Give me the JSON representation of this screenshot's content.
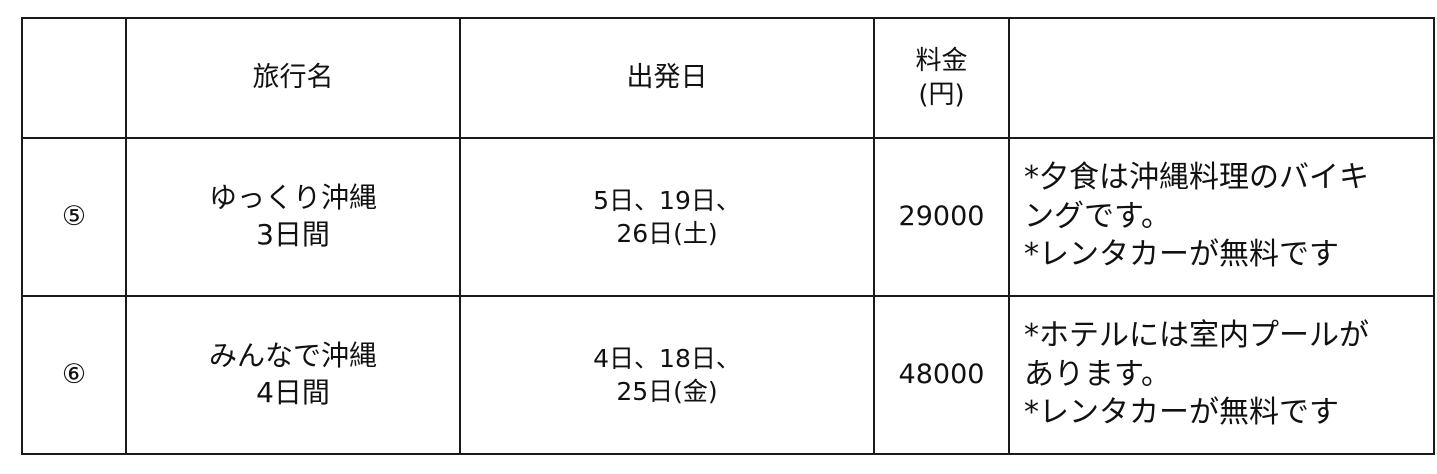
{
  "header": {
    "num": "",
    "name": "旅行名",
    "date": "出発日",
    "price_line1": "料金",
    "price_line2": "(円)",
    "note": ""
  },
  "rows": [
    {
      "num": "⑤",
      "name_line1": "ゆっくり沖縄",
      "name_line2": "3日間",
      "date_line1": "5日、19日、",
      "date_line2": "26日(土)",
      "price": "29000",
      "note_line1": "*夕食は沖縄料理のバイキ",
      "note_line2": "ングです。",
      "note_line3": "*レンタカーが無料です"
    },
    {
      "num": "⑥",
      "name_line1": "みんなで沖縄",
      "name_line2": "4日間",
      "date_line1": "4日、18日、",
      "date_line2": "25日(金)",
      "price": "48000",
      "note_line1": "*ホテルには室内プールが",
      "note_line2": "あります。",
      "note_line3": "*レンタカーが無料です"
    }
  ]
}
